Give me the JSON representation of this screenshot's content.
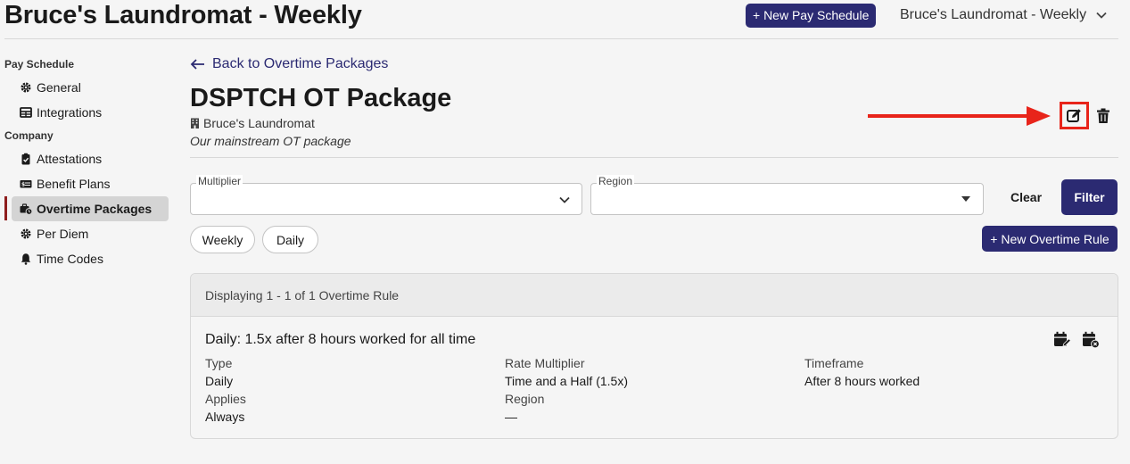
{
  "header": {
    "title": "Bruce's Laundromat - Weekly",
    "new_pay_schedule": "+ New Pay Schedule",
    "schedule_selector": "Bruce's Laundromat - Weekly"
  },
  "sidebar": {
    "sections": [
      "Pay Schedule",
      "Company"
    ],
    "items": [
      {
        "label": "General",
        "icon": "gear-icon"
      },
      {
        "label": "Integrations",
        "icon": "table-icon"
      },
      {
        "label": "Attestations",
        "icon": "clipboard-check-icon"
      },
      {
        "label": "Benefit Plans",
        "icon": "money-check-icon"
      },
      {
        "label": "Overtime Packages",
        "icon": "business-time-icon",
        "active": true
      },
      {
        "label": "Per Diem",
        "icon": "gear-icon"
      },
      {
        "label": "Time Codes",
        "icon": "bell-icon"
      }
    ]
  },
  "package": {
    "back_link": "Back to Overtime Packages",
    "title": "DSPTCH OT Package",
    "company": "Bruce's Laundromat",
    "description": "Our mainstream OT package"
  },
  "filters": {
    "multiplier_label": "Multiplier",
    "multiplier_value": "",
    "region_label": "Region",
    "region_value": "",
    "clear": "Clear",
    "filter": "Filter",
    "pills": [
      "Weekly",
      "Daily"
    ],
    "new_rule": "+ New Overtime Rule"
  },
  "results": {
    "summary": "Displaying 1 - 1 of 1 Overtime Rule",
    "rule": {
      "title": "Daily: 1.5x after 8 hours worked for all time",
      "fields": [
        {
          "key": "Type",
          "value": "Daily"
        },
        {
          "key": "Rate Multiplier",
          "value": "Time and a Half (1.5x)"
        },
        {
          "key": "Timeframe",
          "value": "After 8 hours worked"
        },
        {
          "key": "Applies",
          "value": "Always"
        },
        {
          "key": "Region",
          "value": "—"
        }
      ]
    }
  },
  "colors": {
    "accent": "#2b2a72",
    "highlight": "#e8241a",
    "active_marker": "#8e1d1d"
  }
}
